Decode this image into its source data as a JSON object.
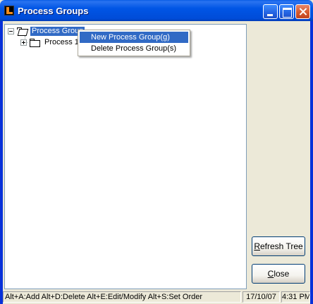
{
  "window": {
    "title": "Process Groups",
    "accent_color": "#0055E5",
    "close_color": "#D65A2E"
  },
  "tree": {
    "root": {
      "label": "Process Group",
      "expanded": true,
      "selected": true
    },
    "children": [
      {
        "label": "Process 1",
        "expanded": false
      }
    ]
  },
  "context_menu": {
    "items": [
      {
        "label": "New Process Group(g)",
        "highlighted": true
      },
      {
        "label": "Delete Process Group(s)",
        "highlighted": false
      }
    ]
  },
  "buttons": {
    "refresh": {
      "mnemonic": "R",
      "rest": "efresh Tree"
    },
    "close": {
      "mnemonic": "C",
      "rest": "lose"
    }
  },
  "statusbar": {
    "hints": "Alt+A:Add   Alt+D:Delete   Alt+E:Edit/Modify   Alt+S:Set Order",
    "date": "17/10/07",
    "time": "4:31 PM"
  }
}
